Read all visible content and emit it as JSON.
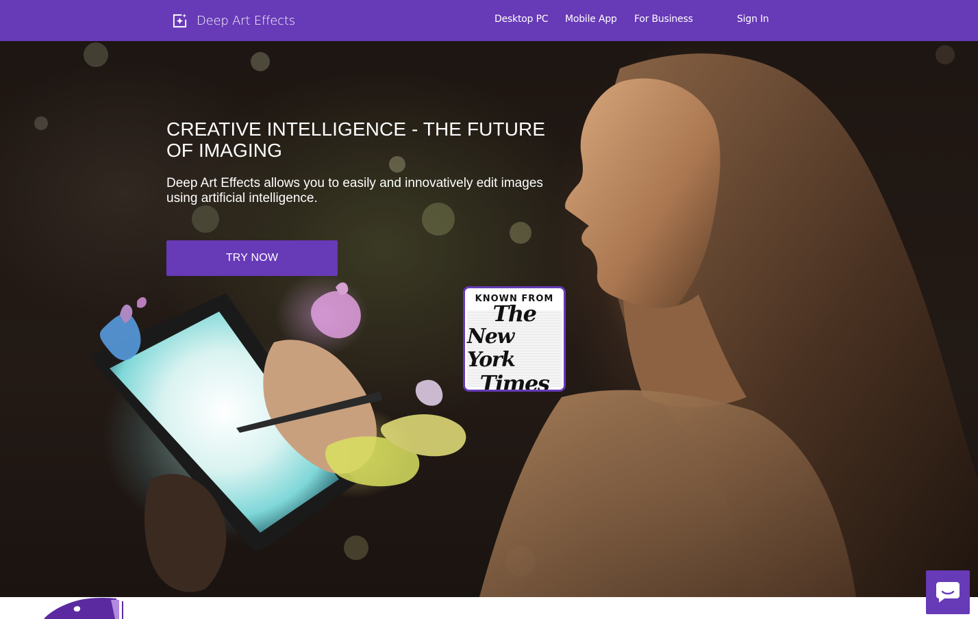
{
  "colors": {
    "brand": "#673ab7",
    "text_on_brand": "#ffffff",
    "hero_background": "#1e1612"
  },
  "header": {
    "brand_name": "Deep Art Effects",
    "brand_icon": "sparkle-frame-icon",
    "nav": [
      {
        "label": "Desktop PC"
      },
      {
        "label": "Mobile App"
      },
      {
        "label": "For Business"
      }
    ],
    "sign_in_label": "Sign In"
  },
  "hero": {
    "title": "CREATIVE INTELLIGENCE - THE FUTURE OF IMAGING",
    "subtitle": "Deep Art Effects allows you to easily and innovatively edit images using artificial intelligence.",
    "cta_label": "TRY NOW"
  },
  "press_badge": {
    "caption": "KNOWN FROM",
    "logo_lines": [
      "The",
      "New York",
      "Times"
    ]
  },
  "chat_widget": {
    "icon": "chat-bubble-icon"
  }
}
